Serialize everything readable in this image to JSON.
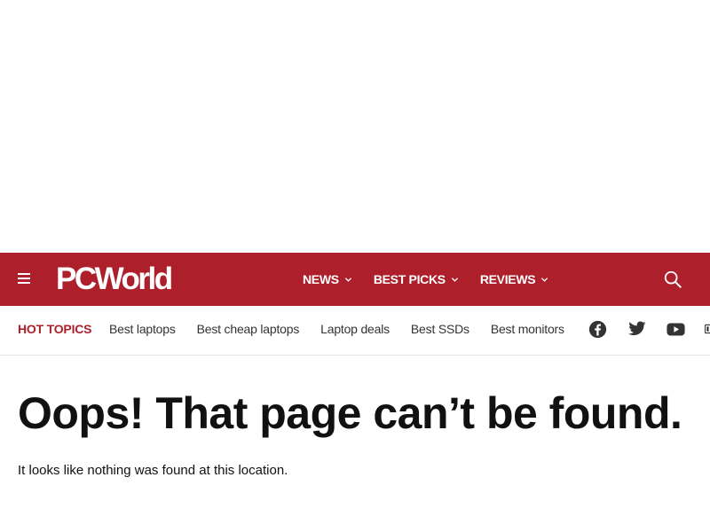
{
  "header": {
    "logo_text": "PCWorld",
    "menu_icon": "hamburger-menu-icon",
    "nav": [
      {
        "label": "NEWS"
      },
      {
        "label": "BEST PICKS"
      },
      {
        "label": "REVIEWS"
      }
    ],
    "search_icon": "search-icon"
  },
  "hot_topics": {
    "label": "HOT TOPICS",
    "items": [
      {
        "label": "Best laptops"
      },
      {
        "label": "Best cheap laptops"
      },
      {
        "label": "Laptop deals"
      },
      {
        "label": "Best SSDs"
      },
      {
        "label": "Best monitors"
      }
    ],
    "social": [
      "facebook-icon",
      "twitter-icon",
      "youtube-icon",
      "flipboard-icon"
    ]
  },
  "main": {
    "title": "Oops! That page can’t be found.",
    "message": "It looks like nothing was found at this location."
  },
  "colors": {
    "brand_red": "#ad1f2b",
    "text_dark": "#111111",
    "icon_gray": "#333333"
  }
}
